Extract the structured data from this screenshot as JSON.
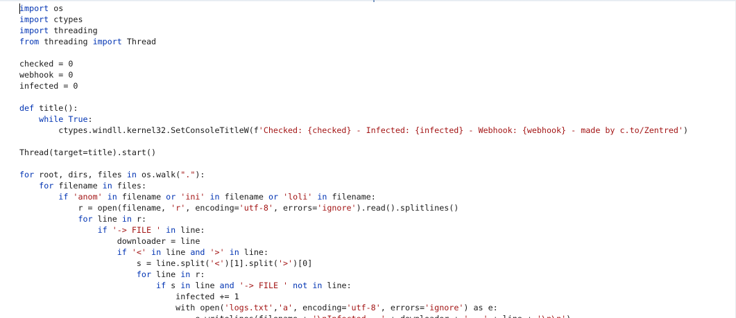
{
  "editor": {
    "colors": {
      "keyword": "#0033b3",
      "string": "#a31515",
      "plain": "#1a1a1a"
    },
    "lines": [
      [
        {
          "t": "kw",
          "s": "import"
        },
        {
          "t": "plain",
          "s": " os"
        }
      ],
      [
        {
          "t": "kw",
          "s": "import"
        },
        {
          "t": "plain",
          "s": " ctypes"
        }
      ],
      [
        {
          "t": "kw",
          "s": "import"
        },
        {
          "t": "plain",
          "s": " threading"
        }
      ],
      [
        {
          "t": "kw",
          "s": "from"
        },
        {
          "t": "plain",
          "s": " threading "
        },
        {
          "t": "kw",
          "s": "import"
        },
        {
          "t": "plain",
          "s": " Thread"
        }
      ],
      [],
      [
        {
          "t": "plain",
          "s": "checked = 0"
        }
      ],
      [
        {
          "t": "plain",
          "s": "webhook = 0"
        }
      ],
      [
        {
          "t": "plain",
          "s": "infected = 0"
        }
      ],
      [],
      [
        {
          "t": "kw",
          "s": "def"
        },
        {
          "t": "plain",
          "s": " title():"
        }
      ],
      [
        {
          "t": "plain",
          "s": "    "
        },
        {
          "t": "kw",
          "s": "while"
        },
        {
          "t": "plain",
          "s": " "
        },
        {
          "t": "kw",
          "s": "True"
        },
        {
          "t": "plain",
          "s": ":"
        }
      ],
      [
        {
          "t": "plain",
          "s": "        ctypes.windll.kernel32.SetConsoleTitleW(f"
        },
        {
          "t": "str",
          "s": "'Checked: {checked} - Infected: {infected} - Webhook: {webhook} - made by c.to/Zentred'"
        },
        {
          "t": "plain",
          "s": ")"
        }
      ],
      [],
      [
        {
          "t": "plain",
          "s": "Thread(target=title).start()"
        }
      ],
      [],
      [
        {
          "t": "kw",
          "s": "for"
        },
        {
          "t": "plain",
          "s": " root, dirs, files "
        },
        {
          "t": "kw",
          "s": "in"
        },
        {
          "t": "plain",
          "s": " os.walk("
        },
        {
          "t": "str",
          "s": "\".\""
        },
        {
          "t": "plain",
          "s": "):"
        }
      ],
      [
        {
          "t": "plain",
          "s": "    "
        },
        {
          "t": "kw",
          "s": "for"
        },
        {
          "t": "plain",
          "s": " filename "
        },
        {
          "t": "kw",
          "s": "in"
        },
        {
          "t": "plain",
          "s": " files:"
        }
      ],
      [
        {
          "t": "plain",
          "s": "        "
        },
        {
          "t": "kw",
          "s": "if"
        },
        {
          "t": "plain",
          "s": " "
        },
        {
          "t": "str",
          "s": "'anom'"
        },
        {
          "t": "plain",
          "s": " "
        },
        {
          "t": "kw",
          "s": "in"
        },
        {
          "t": "plain",
          "s": " filename "
        },
        {
          "t": "kw",
          "s": "or"
        },
        {
          "t": "plain",
          "s": " "
        },
        {
          "t": "str",
          "s": "'ini'"
        },
        {
          "t": "plain",
          "s": " "
        },
        {
          "t": "kw",
          "s": "in"
        },
        {
          "t": "plain",
          "s": " filename "
        },
        {
          "t": "kw",
          "s": "or"
        },
        {
          "t": "plain",
          "s": " "
        },
        {
          "t": "str",
          "s": "'loli'"
        },
        {
          "t": "plain",
          "s": " "
        },
        {
          "t": "kw",
          "s": "in"
        },
        {
          "t": "plain",
          "s": " filename:"
        }
      ],
      [
        {
          "t": "plain",
          "s": "            r = open(filename, "
        },
        {
          "t": "str",
          "s": "'r'"
        },
        {
          "t": "plain",
          "s": ", encoding="
        },
        {
          "t": "str",
          "s": "'utf-8'"
        },
        {
          "t": "plain",
          "s": ", errors="
        },
        {
          "t": "str",
          "s": "'ignore'"
        },
        {
          "t": "plain",
          "s": ").read().splitlines()"
        }
      ],
      [
        {
          "t": "plain",
          "s": "            "
        },
        {
          "t": "kw",
          "s": "for"
        },
        {
          "t": "plain",
          "s": " line "
        },
        {
          "t": "kw",
          "s": "in"
        },
        {
          "t": "plain",
          "s": " r:"
        }
      ],
      [
        {
          "t": "plain",
          "s": "                "
        },
        {
          "t": "kw",
          "s": "if"
        },
        {
          "t": "plain",
          "s": " "
        },
        {
          "t": "str",
          "s": "'-> FILE '"
        },
        {
          "t": "plain",
          "s": " "
        },
        {
          "t": "kw",
          "s": "in"
        },
        {
          "t": "plain",
          "s": " line:"
        }
      ],
      [
        {
          "t": "plain",
          "s": "                    downloader = line"
        }
      ],
      [
        {
          "t": "plain",
          "s": "                    "
        },
        {
          "t": "kw",
          "s": "if"
        },
        {
          "t": "plain",
          "s": " "
        },
        {
          "t": "str",
          "s": "'<'"
        },
        {
          "t": "plain",
          "s": " "
        },
        {
          "t": "kw",
          "s": "in"
        },
        {
          "t": "plain",
          "s": " line "
        },
        {
          "t": "kw",
          "s": "and"
        },
        {
          "t": "plain",
          "s": " "
        },
        {
          "t": "str",
          "s": "'>'"
        },
        {
          "t": "plain",
          "s": " "
        },
        {
          "t": "kw",
          "s": "in"
        },
        {
          "t": "plain",
          "s": " line:"
        }
      ],
      [
        {
          "t": "plain",
          "s": "                        s = line.split("
        },
        {
          "t": "str",
          "s": "'<'"
        },
        {
          "t": "plain",
          "s": ")[1].split("
        },
        {
          "t": "str",
          "s": "'>'"
        },
        {
          "t": "plain",
          "s": ")[0]"
        }
      ],
      [
        {
          "t": "plain",
          "s": "                        "
        },
        {
          "t": "kw",
          "s": "for"
        },
        {
          "t": "plain",
          "s": " line "
        },
        {
          "t": "kw",
          "s": "in"
        },
        {
          "t": "plain",
          "s": " r:"
        }
      ],
      [
        {
          "t": "plain",
          "s": "                            "
        },
        {
          "t": "kw",
          "s": "if"
        },
        {
          "t": "plain",
          "s": " s "
        },
        {
          "t": "kw",
          "s": "in"
        },
        {
          "t": "plain",
          "s": " line "
        },
        {
          "t": "kw",
          "s": "and"
        },
        {
          "t": "plain",
          "s": " "
        },
        {
          "t": "str",
          "s": "'-> FILE '"
        },
        {
          "t": "plain",
          "s": " "
        },
        {
          "t": "kw",
          "s": "not"
        },
        {
          "t": "plain",
          "s": " "
        },
        {
          "t": "kw",
          "s": "in"
        },
        {
          "t": "plain",
          "s": " line:"
        }
      ],
      [
        {
          "t": "plain",
          "s": "                                infected += 1"
        }
      ],
      [
        {
          "t": "plain",
          "s": "                                with open("
        },
        {
          "t": "str",
          "s": "'logs.txt'"
        },
        {
          "t": "plain",
          "s": ","
        },
        {
          "t": "str",
          "s": "'a'"
        },
        {
          "t": "plain",
          "s": ", encoding="
        },
        {
          "t": "str",
          "s": "'utf-8'"
        },
        {
          "t": "plain",
          "s": ", errors="
        },
        {
          "t": "str",
          "s": "'ignore'"
        },
        {
          "t": "plain",
          "s": ") as e:"
        }
      ],
      [
        {
          "t": "plain",
          "s": "                                    e.writelines(filename + "
        },
        {
          "t": "str",
          "s": "'\\nInfected...'"
        },
        {
          "t": "plain",
          "s": " + downloader + "
        },
        {
          "t": "str",
          "s": "'...'"
        },
        {
          "t": "plain",
          "s": " + line + "
        },
        {
          "t": "str",
          "s": "'\\n\\n'"
        },
        {
          "t": "plain",
          "s": ")"
        }
      ]
    ]
  }
}
